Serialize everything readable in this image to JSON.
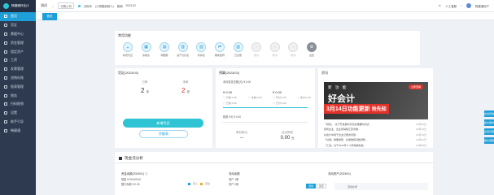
{
  "app": {
    "logo_text": "畅捷通好会计"
  },
  "sidebar": {
    "items": [
      {
        "label": "首页",
        "active": true
      },
      {
        "label": "凭证"
      },
      {
        "label": "票据中心"
      },
      {
        "label": "资金管理"
      },
      {
        "label": "固定资产"
      },
      {
        "label": "工资"
      },
      {
        "label": "发票管理"
      },
      {
        "label": "进销存账"
      },
      {
        "label": "报表管理"
      },
      {
        "label": "税务"
      },
      {
        "label": "扫码报销"
      },
      {
        "label": "设置"
      },
      {
        "label": "助手引导"
      },
      {
        "label": "畅捷通"
      }
    ]
  },
  "topbar": {
    "company": "测试",
    "switch_label": "切换公司",
    "status": "试用中",
    "taxpayer": "(小规模纳税人)",
    "period_label": "账期",
    "period": "2023-02",
    "customer_service": "人工客服",
    "username": "畅捷通用户"
  },
  "tabs": [
    {
      "label": "首页"
    }
  ],
  "common": {
    "title": "常用功能",
    "items": [
      {
        "label": "新增凭证",
        "icon": "plus-doc-icon"
      },
      {
        "label": "余额表",
        "icon": "table-icon"
      },
      {
        "label": "明细账",
        "icon": "book-icon"
      },
      {
        "label": "资产负债表",
        "icon": "balance-icon"
      },
      {
        "label": "利润表",
        "icon": "chart-icon"
      },
      {
        "label": "期末结转",
        "icon": "transfer-icon"
      },
      {
        "label": "日记账",
        "icon": "journal-icon"
      },
      {
        "label": "敬请",
        "icon": "lock-icon",
        "disabled": true
      },
      {
        "label": "敬请",
        "icon": "lock-icon",
        "disabled": true
      },
      {
        "label": "敬请",
        "icon": "lock-icon",
        "disabled": true
      },
      {
        "label": "设置",
        "icon": "gear-icon",
        "settings": true
      }
    ]
  },
  "voucher": {
    "title": "凭证(2023/02)",
    "left_label": "已审",
    "left_value": "2",
    "left_unit": "张",
    "right_label": "未审",
    "right_value": "2",
    "right_unit": "张",
    "primary_btn": "新增凭证",
    "secondary_btn": "余额表"
  },
  "budget": {
    "title": "预算(2023/02)",
    "total_label": "本月收支总额(元)",
    "total_value": "¥ 0.00",
    "income_value": "¥ 0.00",
    "expense_value": "¥ 0.00",
    "income_received": "◇ 已收 0.00",
    "income_pending": "◇ 未收 0.00",
    "expense_paid": "◇ 已付 0.00",
    "expense_pending": "◇ 未付 0.00",
    "tax_label": "税费",
    "tax_value": "0元",
    "tax_amount": "¥ 0.00",
    "profit_label": "净利润/元",
    "profit_value": "--",
    "margin_label": "应交所税",
    "margin_value": "0.00",
    "margin_unit": "元"
  },
  "news": {
    "title": "资讯",
    "banner_l1": "新 功 能",
    "banner_l2": "好会计",
    "banner_l3": "3月14日功能更新",
    "banner_l4": "抢先知",
    "banner_btn": "立即查看",
    "items": [
      {
        "text": "「财务」: 关于开发票时涉及的重要时间点...",
        "date": "02月15日"
      },
      {
        "text": "建筑企业、企业所得税汇算清缴...",
        "date": "02月15日"
      },
      {
        "text": "好会计中用于企业记账的问题...",
        "date": "02月13日"
      },
      {
        "text": "「社保」重要通知：社保缴费基数调整...",
        "date": "02月10日"
      },
      {
        "text": "「工资」关于2023年个人所得税新政...",
        "date": "02月08日"
      }
    ]
  },
  "floats": [
    "在线咨询",
    "提交需求",
    "反馈问题",
    "联系客服"
  ],
  "cash": {
    "title": "现金流分析",
    "fund_title": "资金余额(2023/01)",
    "cash_label": "现金",
    "cash_value": "¥ 99,400.00",
    "bank_label": "银行存款",
    "bank_value": "¥ 0.00",
    "legend_in": "流入",
    "legend_out": "流出",
    "flow_title": "流动余额",
    "flow_in_label": "收户",
    "flow_in_value": "1家",
    "flow_out_label": "供户",
    "flow_out_value": "0家",
    "assets_title": "流动资产(2023/01)",
    "tab_a": "流动",
    "tab_b": "固定",
    "assets_item": "流动比率"
  }
}
